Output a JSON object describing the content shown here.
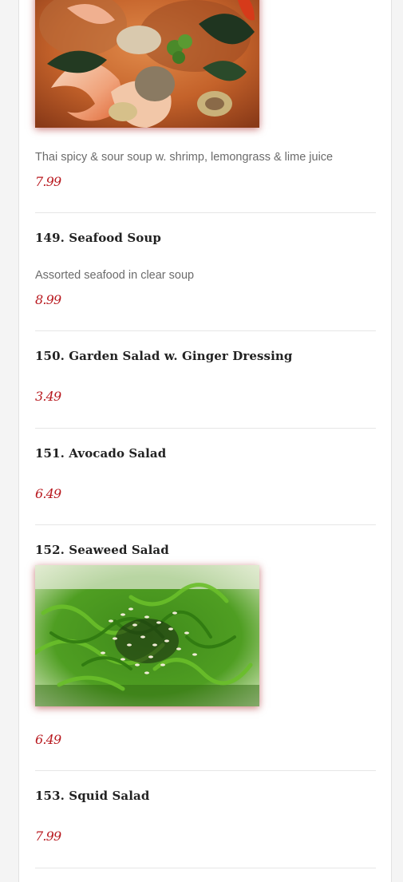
{
  "menu": {
    "items": [
      {
        "id": "148",
        "description": "Thai spicy & sour soup w. shrimp, lemongrass & lime juice",
        "price": "7.99",
        "image": "tom-yum-soup-photo"
      },
      {
        "id": "149",
        "title": "149. Seafood Soup",
        "description": "Assorted seafood in clear soup",
        "price": "8.99"
      },
      {
        "id": "150",
        "title": "150. Garden Salad w. Ginger Dressing",
        "price": "3.49"
      },
      {
        "id": "151",
        "title": "151. Avocado Salad",
        "price": "6.49"
      },
      {
        "id": "152",
        "title": "152. Seaweed Salad",
        "price": "6.49",
        "image": "seaweed-salad-photo"
      },
      {
        "id": "153",
        "title": "153. Squid Salad",
        "price": "7.99"
      }
    ]
  },
  "colors": {
    "price": "#b8191f",
    "title": "#222222",
    "description": "#6b6b6b",
    "divider": "#e6e6e6",
    "background": "#f4f4f4",
    "card": "#ffffff"
  }
}
